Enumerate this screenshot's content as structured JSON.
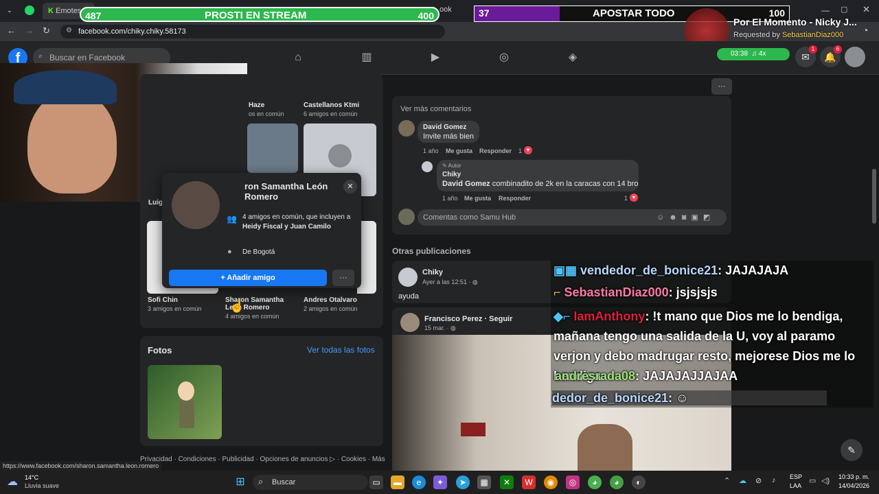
{
  "browser": {
    "tab_label": "Emotes",
    "tab_right_label": "ook",
    "url": "facebook.com/chiky.chiky.58173",
    "status_url": "https://www.facebook.com/sharon.samantha.leon.romero"
  },
  "overlay": {
    "left_bar": {
      "left_num": "487",
      "title": "PROSTI EN STREAM",
      "right_num": "400",
      "color": "#2db84d"
    },
    "right_bar": {
      "left_num": "37",
      "title": "APOSTAR TODO",
      "right_num": "100",
      "fill_fraction": 0.27,
      "color": "#6a1b9a"
    },
    "song_title": "Por El Momento - Nicky J...",
    "requested_by_label": "Requested by",
    "requested_by_user": "SebastianDiaz000",
    "timer": "03:38",
    "speed": "4x"
  },
  "facebook": {
    "search_placeholder": "Buscar en Facebook",
    "notif_messenger": "1",
    "notif_bell": "6",
    "friends": {
      "top_names": [
        {
          "name": "Haze",
          "sub": "os en común"
        },
        {
          "name": "Castellanos Ktmi",
          "sub": "6 amigos en común"
        }
      ],
      "bottom_names": [
        {
          "name": "Sofi Chin",
          "sub": "3 amigos en común"
        },
        {
          "name": "Sharon Samantha León Romero",
          "sub": "4 amigos en común"
        },
        {
          "name": "Andres Otalvaro",
          "sub": "2 amigos en común"
        }
      ],
      "left_cut_name": "Luigy"
    },
    "hovercard": {
      "name": "ron Samantha León Romero",
      "mutual": "4 amigos en común, que incluyen a",
      "mutual_names": "Heidy Fiscal y Juan Camilo",
      "location": "De Bogotá",
      "add_button": "Añadir amigo",
      "more": "···"
    },
    "photos": {
      "title": "Fotos",
      "see_all": "Ver todas las fotos"
    },
    "footer": "Privacidad · Condiciones · Publicidad · Opciones de anuncios ▷ · Cookies · Más",
    "comments": {
      "see_more": "Ver más comentarios",
      "items": [
        {
          "author": "David Gomez",
          "text": "Invite más bien",
          "time": "1 año",
          "like": "Me gusta",
          "reply": "Responder",
          "reactions": "1"
        },
        {
          "author_tag": "Autor",
          "author": "Chiky",
          "mention": "David Gomez",
          "text": "combinadito de 2k en la caracas con 14 bro",
          "time": "1 año",
          "like": "Me gusta",
          "reply": "Responder",
          "reactions": "1"
        }
      ],
      "compose_placeholder": "Comentas como Samu Hub"
    },
    "other_posts": {
      "title": "Otras publicaciones",
      "post1": {
        "author": "Chiky",
        "time": "Ayer a las 12:51 · ",
        "text": "ayuda"
      },
      "post2": {
        "author": "Francisco Perez · Seguir",
        "time": "15 mar. · "
      }
    }
  },
  "chat": [
    {
      "user": "vendedor_de_bonice21",
      "msg": ": JAJAJAJA",
      "color": "#b9d8ff"
    },
    {
      "user": "SebastianDiaz000",
      "msg": ": jsjsjsjs",
      "color": "#ff7aa8"
    },
    {
      "user": "IamAnthony",
      "msg": ": !t mano que Dios me lo bendiga, mañana tengo una salida de la U, voy al paramo verjon y debo madrugar resto, mejorese Dios me lo bendiga",
      "color": "#e0203a"
    },
    {
      "user": "andresrada08",
      "msg": ": JAJAJAJJAJAA",
      "color": "#9be37a"
    },
    {
      "user": "dedor_de_bonice21",
      "msg": ":",
      "color": "#b9d8ff"
    }
  ],
  "taskbar": {
    "weather_temp": "14°C",
    "weather_desc": "Lluvia suave",
    "search": "Buscar",
    "lang1": "ESP",
    "lang2": "LAA",
    "time": "10:33 p. m.",
    "date": "14/04/2026"
  }
}
